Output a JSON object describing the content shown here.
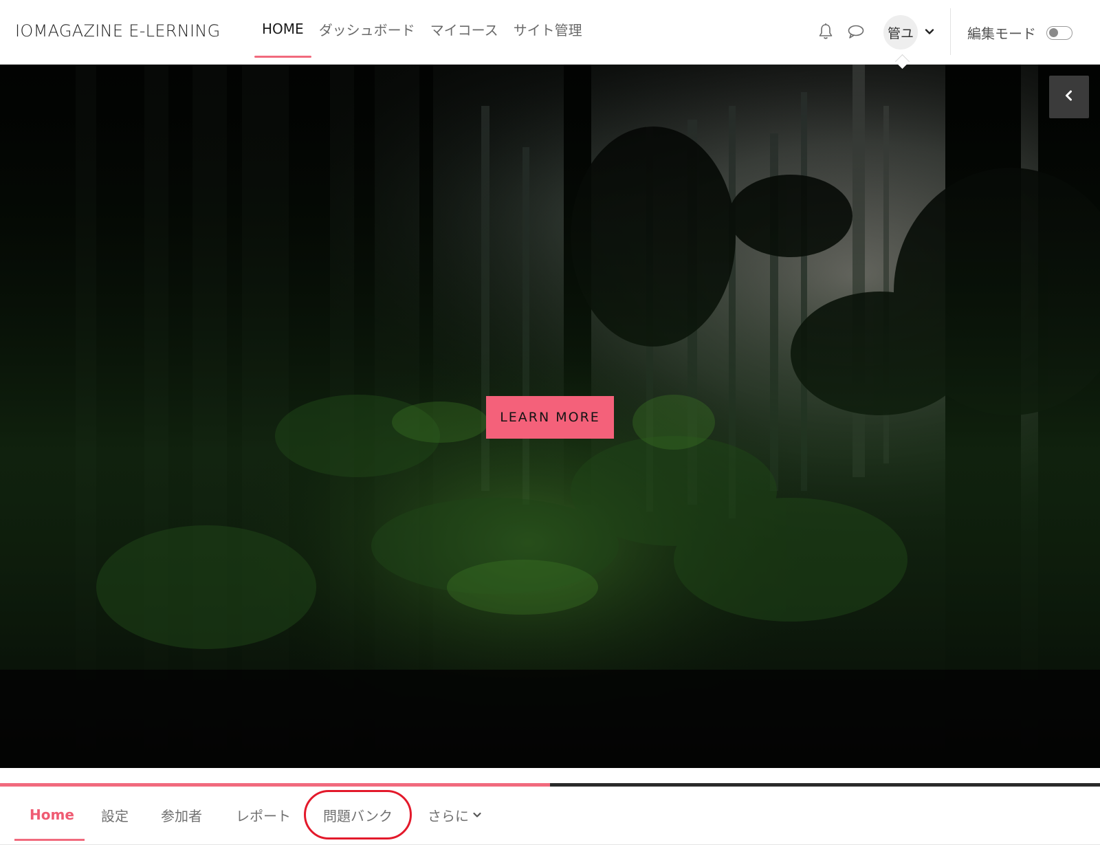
{
  "brand": {
    "name": "IOMAGAZINE E-LERNING"
  },
  "primary_nav": {
    "items": [
      {
        "label": "HOME",
        "active": true
      },
      {
        "label": "ダッシュボード",
        "active": false
      },
      {
        "label": "マイコース",
        "active": false
      },
      {
        "label": "サイト管理",
        "active": false
      }
    ]
  },
  "icons": {
    "notifications": "bell-icon",
    "messages": "chat-bubble-icon",
    "user_menu": "chevron-down-icon",
    "drawer": "chevron-left-icon"
  },
  "user": {
    "avatar_initials": "管ユ"
  },
  "edit_mode": {
    "label": "編集モード",
    "enabled": false
  },
  "hero": {
    "cta_label": "LEARN MORE",
    "slide_progress_fraction": 0.5
  },
  "secondary_nav": {
    "items": [
      {
        "label": "Home",
        "active": true
      },
      {
        "label": "設定",
        "active": false
      },
      {
        "label": "参加者",
        "active": false
      },
      {
        "label": "レポート",
        "active": false
      },
      {
        "label": "問題バンク",
        "active": false,
        "highlighted": true
      },
      {
        "label": "さらに",
        "active": false,
        "has_dropdown": true
      }
    ]
  },
  "colors": {
    "accent": "#f16a7d",
    "cta_background": "#f4617a",
    "highlight_ring": "#e3192b"
  }
}
